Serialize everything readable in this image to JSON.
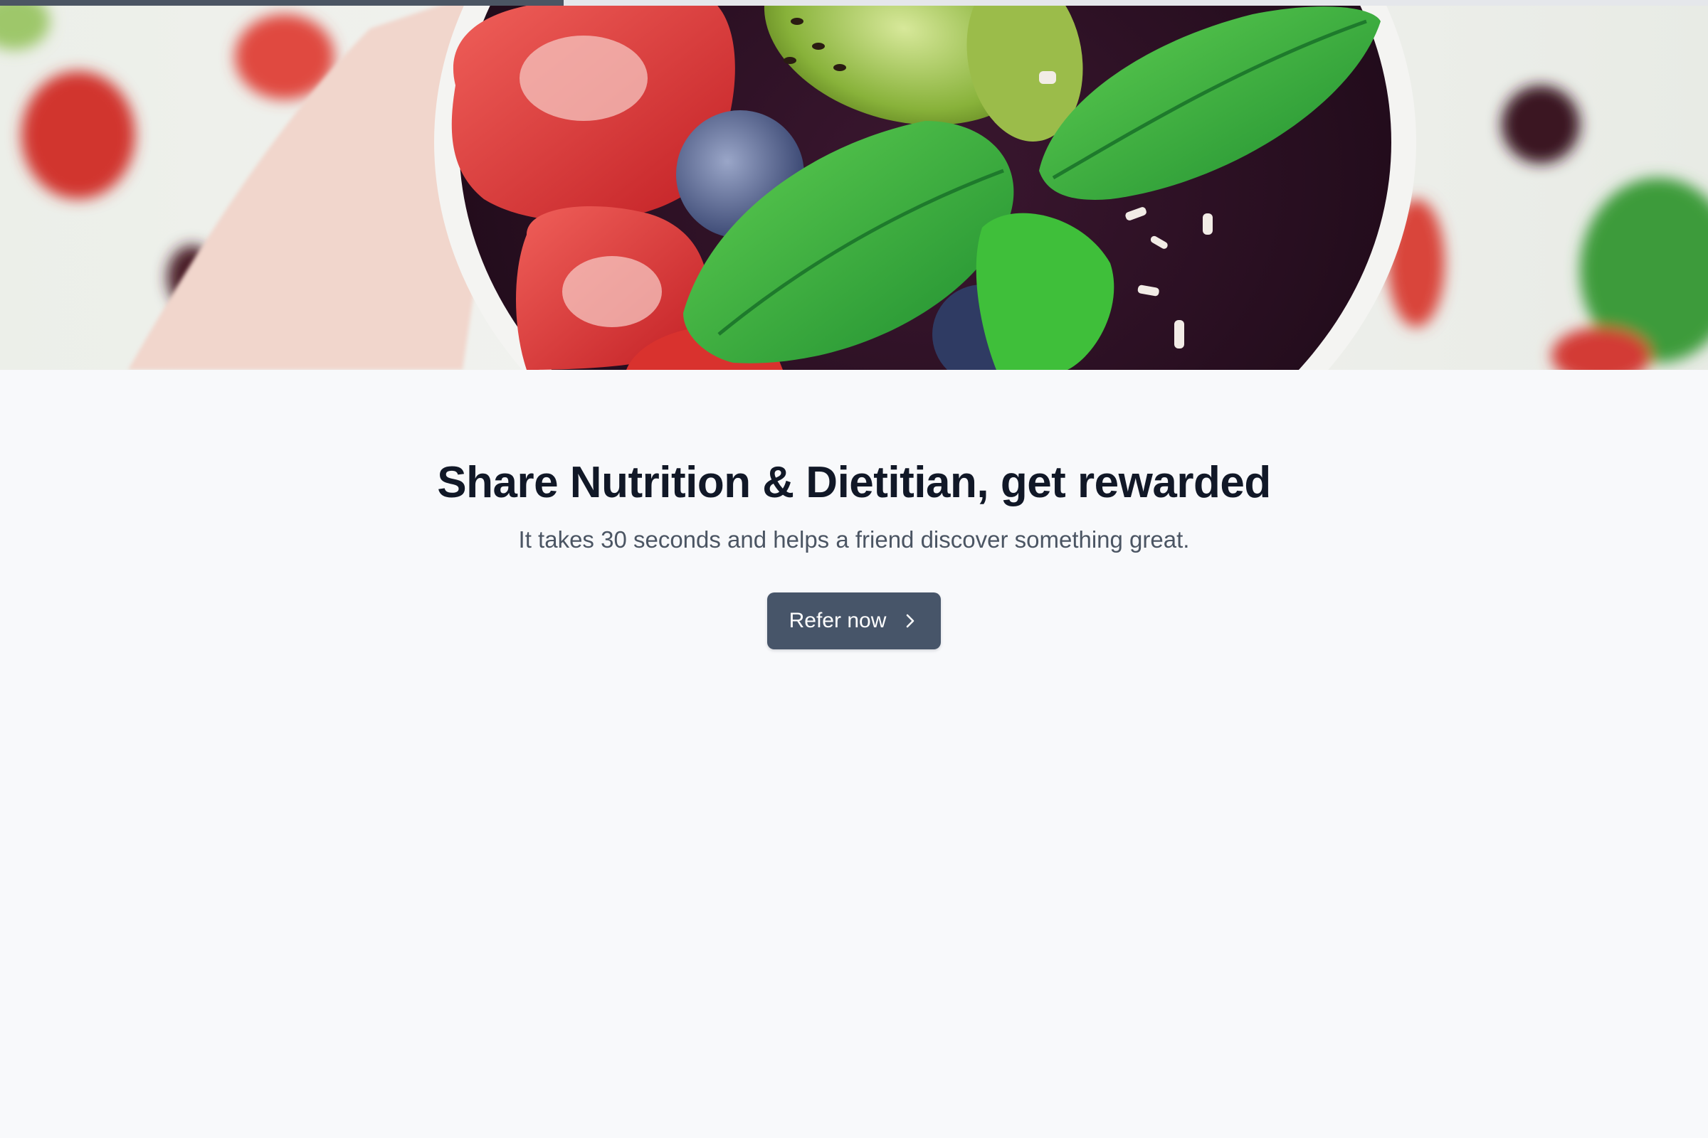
{
  "progress": {
    "value_fraction": 0.33,
    "track_color": "#e5e7eb",
    "fill_color": "#4b5563"
  },
  "hero": {
    "icon": "fruit-bowl-photo"
  },
  "headline": "Share Nutrition & Dietitian, get rewarded",
  "subheadline": "It takes 30 seconds and helps a friend discover something great.",
  "cta": {
    "label": "Refer now",
    "icon": "chevron-right-icon",
    "color": "#475569"
  }
}
